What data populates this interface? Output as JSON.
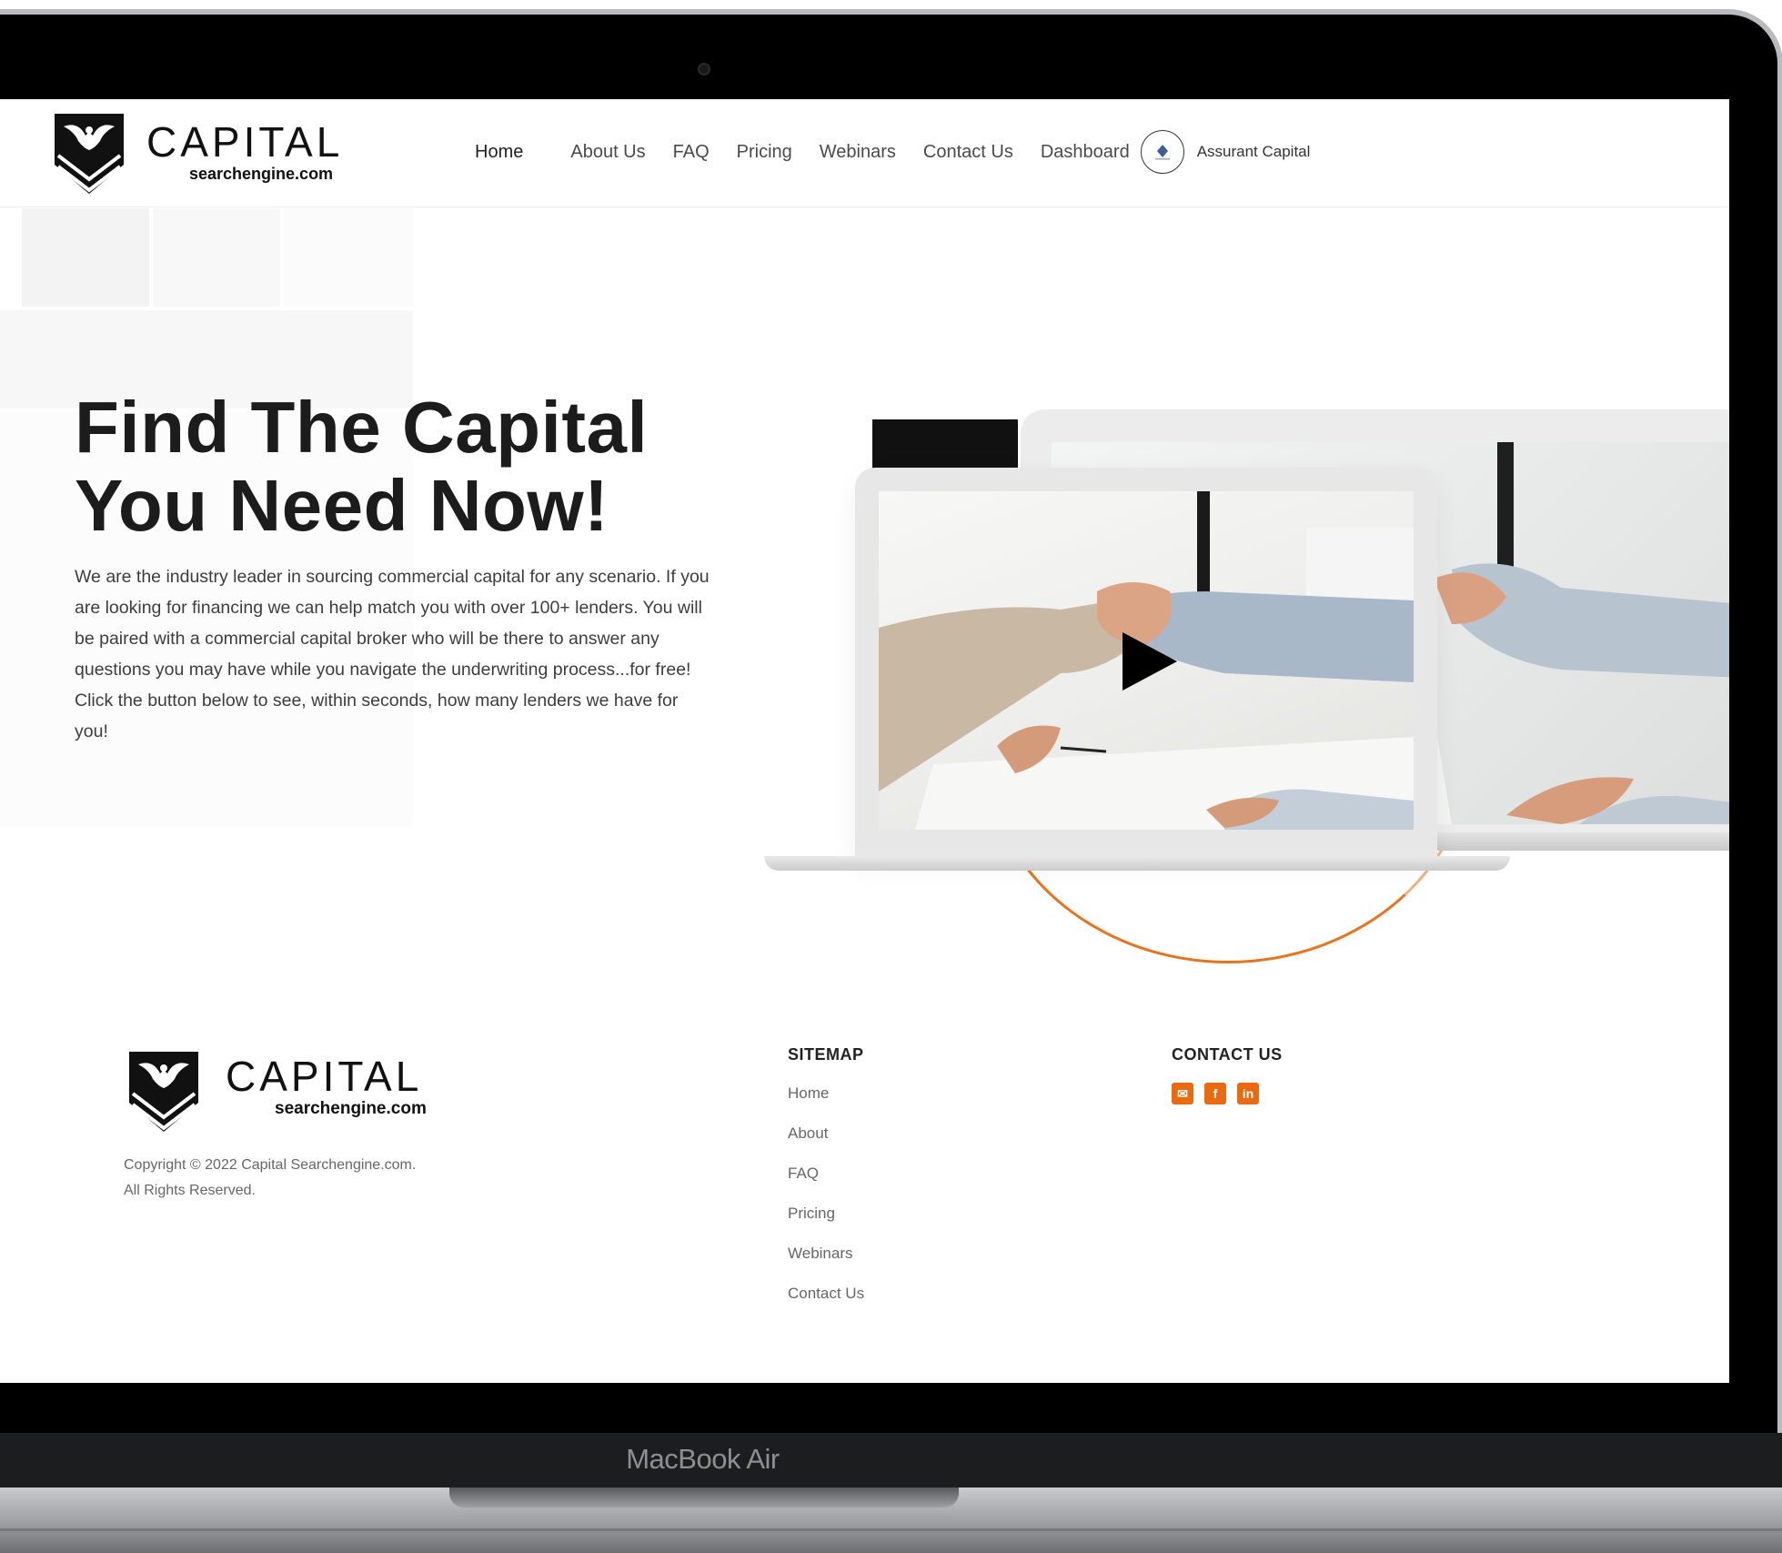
{
  "device": {
    "label": "MacBook Air"
  },
  "brand": {
    "word": "CAPITAL",
    "sub": "searchengine.com"
  },
  "nav": {
    "items": [
      "Home",
      "About Us",
      "FAQ",
      "Pricing",
      "Webinars",
      "Contact Us",
      "Dashboard"
    ],
    "active": "Home",
    "profile_name": "Assurant Capital"
  },
  "hero": {
    "title_line1": "Find The Capital",
    "title_line2": "You Need Now!",
    "text": "We are the industry leader in sourcing commercial capital for any scenario. If you are looking for financing we can help match you with over 100+ lenders. You will be paired with a commercial capital broker who will be there to answer any questions you may have while you navigate the underwriting process...for free! Click the button below to see, within seconds, how many lenders we have for you!",
    "video_icon": "play-icon"
  },
  "footer": {
    "copyright_line1": "Copyright © 2022 Capital Searchengine.com.",
    "copyright_line2": "All Rights Reserved.",
    "sitemap_heading": "SITEMAP",
    "sitemap": [
      "Home",
      "About",
      "FAQ",
      "Pricing",
      "Webinars",
      "Contact Us"
    ],
    "contact_heading": "CONTACT US",
    "social": [
      {
        "icon": "email-icon",
        "glyph": "✉"
      },
      {
        "icon": "facebook-icon",
        "glyph": "f"
      },
      {
        "icon": "linkedin-icon",
        "glyph": "in"
      }
    ]
  },
  "colors": {
    "accent": "#ea6a12",
    "text": "#1c1c1c",
    "frame": "#000000"
  }
}
